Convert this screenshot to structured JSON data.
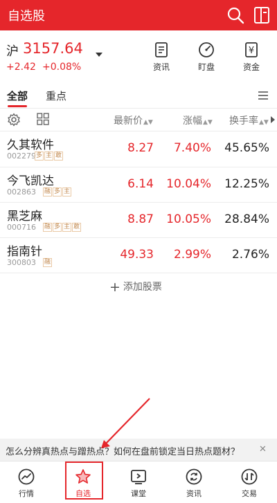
{
  "header": {
    "title": "自选股"
  },
  "index": {
    "name": "沪",
    "price": "3157.64",
    "change": "+2.42",
    "pct": "+0.08%"
  },
  "quick_actions": [
    {
      "label": "资讯",
      "icon": "news-icon"
    },
    {
      "label": "盯盘",
      "icon": "gauge-icon"
    },
    {
      "label": "资金",
      "icon": "yuan-icon"
    }
  ],
  "tabs": [
    {
      "label": "全部"
    },
    {
      "label": "重点"
    }
  ],
  "columns": {
    "price": "最新价",
    "change": "涨幅",
    "turnover": "换手率"
  },
  "stocks": [
    {
      "name": "久其软件",
      "code": "002279",
      "tags": [
        "多",
        "主",
        "敢"
      ],
      "price": "8.27",
      "pct": "7.40%",
      "turnover": "45.65%"
    },
    {
      "name": "今飞凯达",
      "code": "002863",
      "tags": [
        "融",
        "多",
        "主"
      ],
      "price": "6.14",
      "pct": "10.04%",
      "turnover": "12.25%"
    },
    {
      "name": "黑芝麻",
      "code": "000716",
      "tags": [
        "融",
        "多",
        "主",
        "敢"
      ],
      "price": "8.87",
      "pct": "10.05%",
      "turnover": "28.84%"
    },
    {
      "name": "指南针",
      "code": "300803",
      "tags": [
        "融"
      ],
      "price": "49.33",
      "pct": "2.99%",
      "turnover": "2.76%"
    }
  ],
  "add_stock": "添加股票",
  "banner": {
    "text": "怎么分辨真热点与蹭热点？如何在盘前锁定当日热点题材？",
    "close": "✕"
  },
  "tabbar": [
    {
      "label": "行情",
      "icon": "trend-icon"
    },
    {
      "label": "自选",
      "icon": "star-icon",
      "active": true
    },
    {
      "label": "课堂",
      "icon": "play-icon"
    },
    {
      "label": "资讯",
      "icon": "refresh-icon"
    },
    {
      "label": "交易",
      "icon": "trade-icon"
    }
  ],
  "colors": {
    "brand": "#e5262b",
    "up": "#e5262b",
    "tag": "#c28a50"
  }
}
